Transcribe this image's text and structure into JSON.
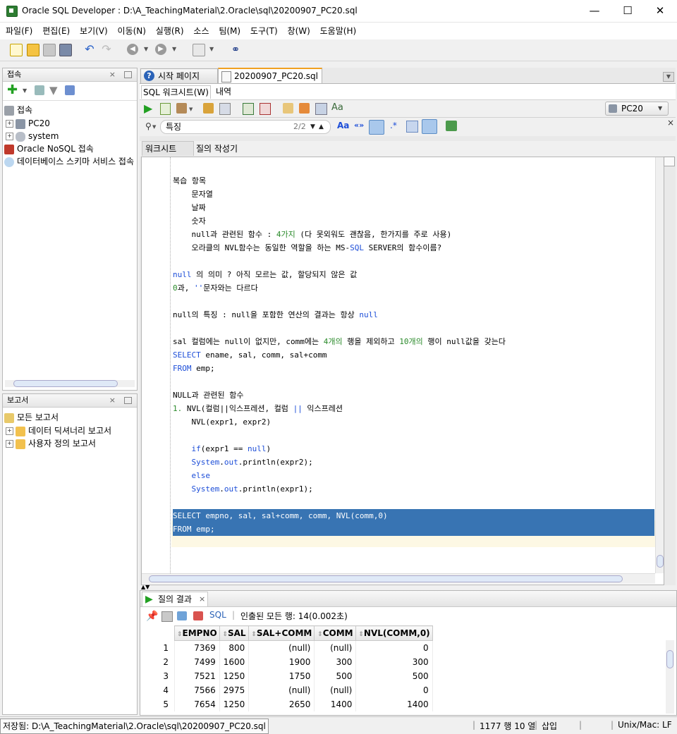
{
  "window": {
    "title": "Oracle SQL Developer : D:\\A_TeachingMaterial\\2.Oracle\\sql\\20200907_PC20.sql",
    "minimize": "—",
    "maximize": "☐",
    "close": "✕"
  },
  "menu": [
    "파일(F)",
    "편집(E)",
    "보기(V)",
    "이동(N)",
    "실행(R)",
    "소스",
    "팀(M)",
    "도구(T)",
    "창(W)",
    "도움말(H)"
  ],
  "connections_panel": {
    "title": "접속",
    "close": "×",
    "tree": [
      {
        "label": "접속",
        "level": 0
      },
      {
        "label": "PC20",
        "level": 1
      },
      {
        "label": "system",
        "level": 1
      },
      {
        "label": "Oracle NoSQL 접속",
        "level": 0
      },
      {
        "label": "데이터베이스 스키마 서비스 접속",
        "level": 0
      }
    ]
  },
  "reports_panel": {
    "title": "보고서",
    "close": "×",
    "tree": [
      {
        "label": "모든 보고서",
        "level": 0
      },
      {
        "label": "데이터 딕셔너리 보고서",
        "level": 1
      },
      {
        "label": "사용자 정의 보고서",
        "level": 1
      }
    ]
  },
  "editor_tabs": [
    {
      "label": "시작 페이지",
      "active": false
    },
    {
      "label": "20200907_PC20.sql",
      "active": true
    }
  ],
  "sub_tabs": {
    "worksheet": "SQL 워크시트(W)",
    "history": "내역"
  },
  "connection_selector": "PC20",
  "find_bar": {
    "query": "특징",
    "count": "2/2",
    "close": "×"
  },
  "inner_tabs": {
    "worksheet": "워크시트",
    "query_builder": "질의 작성기"
  },
  "code_lines": [
    {
      "t": "",
      "segs": []
    },
    {
      "segs": [
        {
          "c": "",
          "t": "복습 항목"
        }
      ]
    },
    {
      "segs": [
        {
          "c": "",
          "t": "    문자열"
        }
      ]
    },
    {
      "segs": [
        {
          "c": "",
          "t": "    날짜"
        }
      ]
    },
    {
      "segs": [
        {
          "c": "",
          "t": "    숫자"
        }
      ]
    },
    {
      "segs": [
        {
          "c": "",
          "t": "    null과 관련된 함수 : "
        },
        {
          "c": "num",
          "t": "4가지"
        },
        {
          "c": "",
          "t": " (다 못외워도 괜찮음, 한가지를 주로 사용)"
        }
      ]
    },
    {
      "segs": [
        {
          "c": "",
          "t": "    오라클의 NVL함수는 동일한 역할을 하는 MS-"
        },
        {
          "c": "kw",
          "t": "SQL"
        },
        {
          "c": "",
          "t": " SERVER의 함수이름?"
        }
      ]
    },
    {
      "segs": []
    },
    {
      "segs": [
        {
          "c": "kw",
          "t": "null"
        },
        {
          "c": "",
          "t": " 의 의미 ? 아직 모르는 값, 할당되지 않은 값"
        }
      ]
    },
    {
      "segs": [
        {
          "c": "num",
          "t": "0"
        },
        {
          "c": "",
          "t": "과, "
        },
        {
          "c": "str",
          "t": "''"
        },
        {
          "c": "",
          "t": "문자와는 다르다"
        }
      ]
    },
    {
      "segs": []
    },
    {
      "segs": [
        {
          "c": "",
          "t": "null의 특징 : null을 포함한 연산의 결과는 항상 "
        },
        {
          "c": "kw",
          "t": "null"
        }
      ]
    },
    {
      "segs": []
    },
    {
      "segs": [
        {
          "c": "",
          "t": "sal 컬럼에는 null이 없지만, comm에는 "
        },
        {
          "c": "num",
          "t": "4개의"
        },
        {
          "c": "",
          "t": " 행을 제외하고 "
        },
        {
          "c": "num",
          "t": "10개의"
        },
        {
          "c": "",
          "t": " 행이 null값을 갖는다"
        }
      ]
    },
    {
      "segs": [
        {
          "c": "kw",
          "t": "SELECT"
        },
        {
          "c": "",
          "t": " ename, sal, comm, sal+comm"
        }
      ]
    },
    {
      "segs": [
        {
          "c": "kw",
          "t": "FROM"
        },
        {
          "c": "",
          "t": " emp;"
        }
      ]
    },
    {
      "segs": []
    },
    {
      "segs": [
        {
          "c": "",
          "t": "NULL과 관련된 함수"
        }
      ]
    },
    {
      "segs": [
        {
          "c": "num",
          "t": "1."
        },
        {
          "c": "",
          "t": " NVL(컬럼||익스프레션, 컬럼 "
        },
        {
          "c": "kw",
          "t": "||"
        },
        {
          "c": "",
          "t": " 익스프레션"
        }
      ]
    },
    {
      "segs": [
        {
          "c": "",
          "t": "    NVL(expr1, expr2)"
        }
      ]
    },
    {
      "segs": []
    },
    {
      "segs": [
        {
          "c": "",
          "t": "    "
        },
        {
          "c": "kw",
          "t": "if"
        },
        {
          "c": "",
          "t": "(expr1 == "
        },
        {
          "c": "kw",
          "t": "null"
        },
        {
          "c": "",
          "t": ")"
        }
      ]
    },
    {
      "segs": [
        {
          "c": "",
          "t": "    "
        },
        {
          "c": "kw",
          "t": "System"
        },
        {
          "c": "",
          "t": "."
        },
        {
          "c": "kw",
          "t": "out"
        },
        {
          "c": "",
          "t": ".println(expr2);"
        }
      ]
    },
    {
      "segs": [
        {
          "c": "",
          "t": "    "
        },
        {
          "c": "kw",
          "t": "else"
        }
      ]
    },
    {
      "segs": [
        {
          "c": "",
          "t": "    "
        },
        {
          "c": "kw",
          "t": "System"
        },
        {
          "c": "",
          "t": "."
        },
        {
          "c": "kw",
          "t": "out"
        },
        {
          "c": "",
          "t": ".println(expr1);"
        }
      ]
    },
    {
      "segs": []
    },
    {
      "segs": [
        {
          "c": "",
          "t": "SELECT empno, sal, sal+comm, comm, NVL(comm,0)"
        }
      ],
      "selected": true
    },
    {
      "segs": [
        {
          "c": "",
          "t": "FROM emp;"
        }
      ],
      "selected": true
    }
  ],
  "results_panel": {
    "tab": "질의 결과",
    "close": "×",
    "sql_link": "SQL",
    "status": "인출된 모든 행: 14(0.002초)",
    "columns": [
      "EMPNO",
      "SAL",
      "SAL+COMM",
      "COMM",
      "NVL(COMM,0)"
    ],
    "rows": [
      [
        "1",
        "7369",
        "800",
        "(null)",
        "(null)",
        "0"
      ],
      [
        "2",
        "7499",
        "1600",
        "1900",
        "300",
        "300"
      ],
      [
        "3",
        "7521",
        "1250",
        "1750",
        "500",
        "500"
      ],
      [
        "4",
        "7566",
        "2975",
        "(null)",
        "(null)",
        "0"
      ],
      [
        "5",
        "7654",
        "1250",
        "2650",
        "1400",
        "1400"
      ]
    ]
  },
  "statusbar": {
    "path": "저장됨: D:\\A_TeachingMaterial\\2.Oracle\\sql\\20200907_PC20.sql",
    "position": "1177 행 10 열",
    "mode": "삽입",
    "line_ending": "Unix/Mac: LF"
  },
  "colors": {
    "selection": "#3874b3",
    "keyword": "#1d4ed8",
    "number": "#2a8a2a",
    "current_line": "#fdf8e4"
  }
}
